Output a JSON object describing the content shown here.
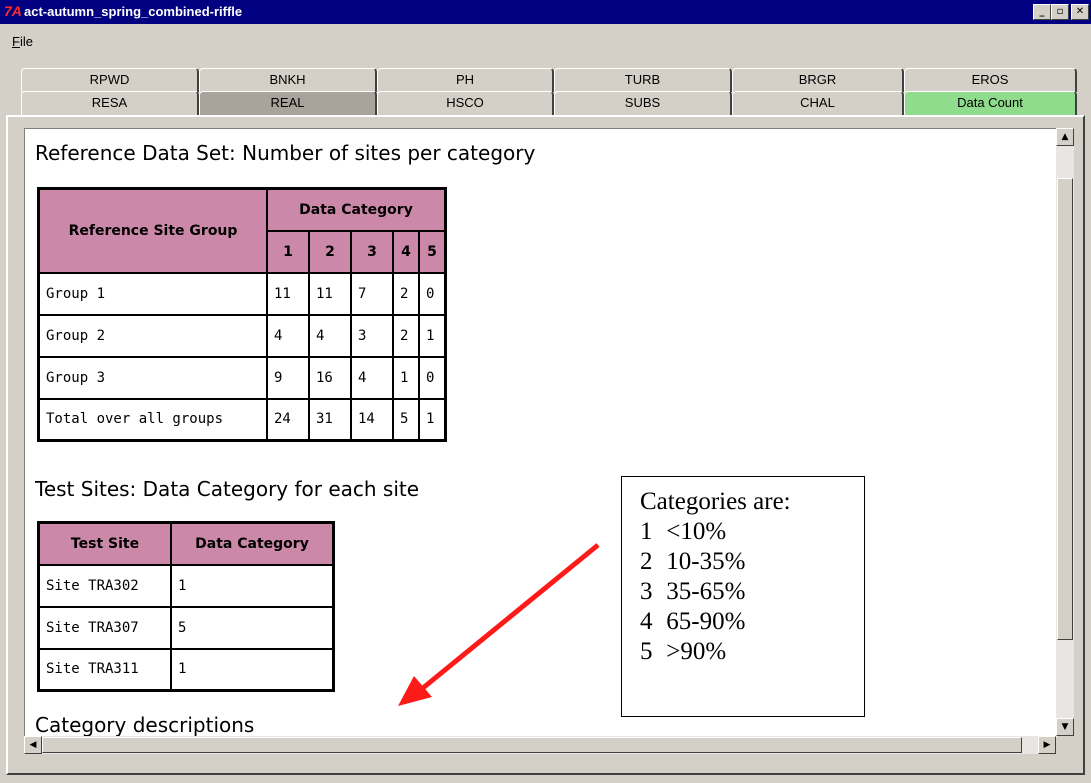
{
  "window": {
    "title": "act-autumn_spring_combined-riffle",
    "icon_glyph": "7A",
    "minimize_glyph": "_",
    "maximize_glyph": "▫",
    "close_glyph": "✕"
  },
  "menu": {
    "file_label": "File",
    "file_mnemonic": "F",
    "file_rest": "ile"
  },
  "tabs_row1": [
    "RPWD",
    "BNKH",
    "PH",
    "TURB",
    "BRGR",
    "EROS"
  ],
  "tabs_row2": [
    "RESA",
    "REAL",
    "HSCO",
    "SUBS",
    "CHAL",
    "Data Count"
  ],
  "colors": {
    "header_pink": "#cc88a8",
    "active_tab_green": "#8fdc8c",
    "arrow_red": "#ff1a1a"
  },
  "reference": {
    "heading": "Reference Data Set: Number of sites per category",
    "group_header": "Reference Site Group",
    "category_header": "Data Category",
    "categories": [
      "1",
      "2",
      "3",
      "4",
      "5"
    ],
    "rows": [
      {
        "label": "Group 1",
        "values": [
          "11",
          "11",
          "7",
          "2",
          "0"
        ]
      },
      {
        "label": "Group 2",
        "values": [
          "4",
          "4",
          "3",
          "2",
          "1"
        ]
      },
      {
        "label": "Group 3",
        "values": [
          "9",
          "16",
          "4",
          "1",
          "0"
        ]
      },
      {
        "label": "Total over all groups",
        "values": [
          "24",
          "31",
          "14",
          "5",
          "1"
        ]
      }
    ]
  },
  "test": {
    "heading": "Test Sites: Data Category for each site",
    "col_site": "Test Site",
    "col_category": "Data Category",
    "rows": [
      {
        "site": "Site TRA302",
        "category": "1"
      },
      {
        "site": "Site TRA307",
        "category": "5"
      },
      {
        "site": "Site TRA311",
        "category": "1"
      }
    ]
  },
  "partial_heading": "Category descriptions",
  "callout": {
    "title": "Categories are:",
    "items": [
      {
        "num": "1",
        "text": "<10%"
      },
      {
        "num": "2",
        "text": "10-35%"
      },
      {
        "num": "3",
        "text": "35-65%"
      },
      {
        "num": "4",
        "text": "65-90%"
      },
      {
        "num": "5",
        "text": ">90%"
      }
    ]
  },
  "scroll": {
    "up": "▲",
    "down": "▼",
    "left": "◀",
    "right": "▶"
  }
}
